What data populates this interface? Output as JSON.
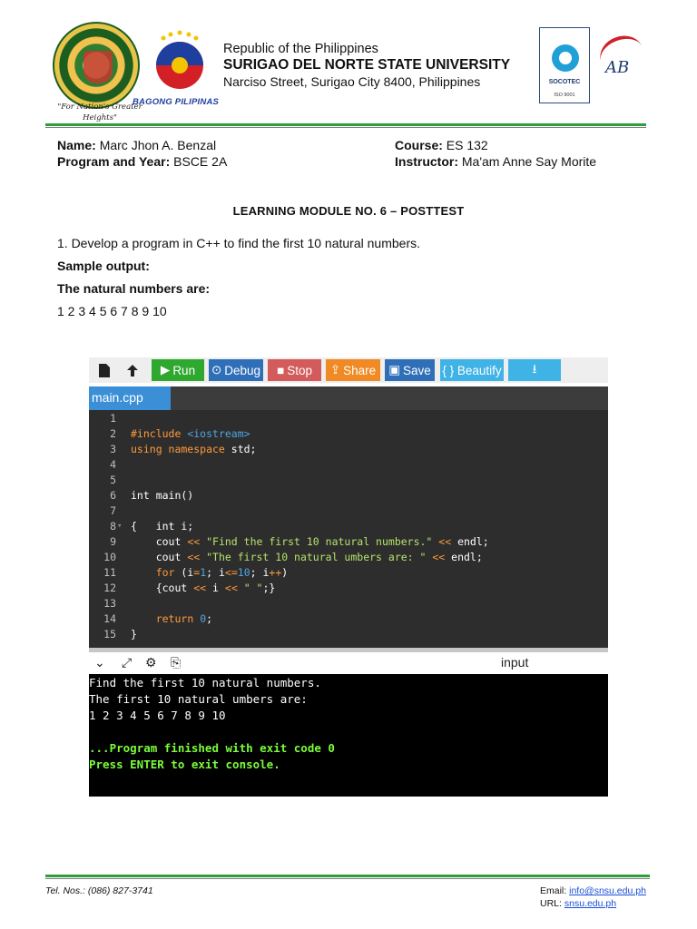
{
  "header": {
    "republic": "Republic of the Philippines",
    "university": "SURIGAO DEL NORTE STATE UNIVERSITY",
    "address": "Narciso Street, Surigao City 8400, Philippines",
    "motto": "\"For Nation's Greater Heights\"",
    "bagong_pilipinas": "BAGONG PILIPINAS",
    "seal_text": "SURIGAO DEL NORTE STATE UNIVERSITY",
    "socotec_name": "SOCOTEC",
    "socotec_iso": "ISO 9001",
    "pab_letters": "AB"
  },
  "student": {
    "name_label": "Name:",
    "name": "Marc Jhon A. Benzal",
    "program_label": "Program and Year:",
    "program": "BSCE 2A",
    "course_label": "Course:",
    "course": "ES 132",
    "instructor_label": "Instructor:",
    "instructor": "Ma'am Anne Say Morite"
  },
  "module": {
    "title": "LEARNING MODULE NO. 6 – POSTTEST",
    "question": "1. Develop a program in C++ to find the first 10 natural numbers.",
    "sample_label": "Sample output:",
    "sample_heading": "The natural numbers are:",
    "sample_values": "1 2 3 4 5 6 7 8 9 10"
  },
  "ide": {
    "toolbar": {
      "run": "Run",
      "debug": "Debug",
      "stop": "Stop",
      "share": "Share",
      "save": "Save",
      "beautify": "{ } Beautify"
    },
    "tab": "main.cpp",
    "input_label": "input",
    "line_numbers": [
      "1",
      "2",
      "3",
      "4",
      "5",
      "6",
      "7",
      "8",
      "9",
      "10",
      "11",
      "12",
      "13",
      "14",
      "15"
    ],
    "console": [
      "Find the first 10 natural numbers.",
      "The first 10 natural umbers are:",
      "1 2 3 4 5 6 7 8 9 10",
      "",
      "...Program finished with exit code 0",
      "Press ENTER to exit console."
    ]
  },
  "footer": {
    "tel": "Tel. Nos.: (086) 827-3741",
    "email_label": "Email:",
    "email": "info@snsu.edu.ph",
    "url_label": "URL:",
    "url": "snsu.edu.ph"
  }
}
